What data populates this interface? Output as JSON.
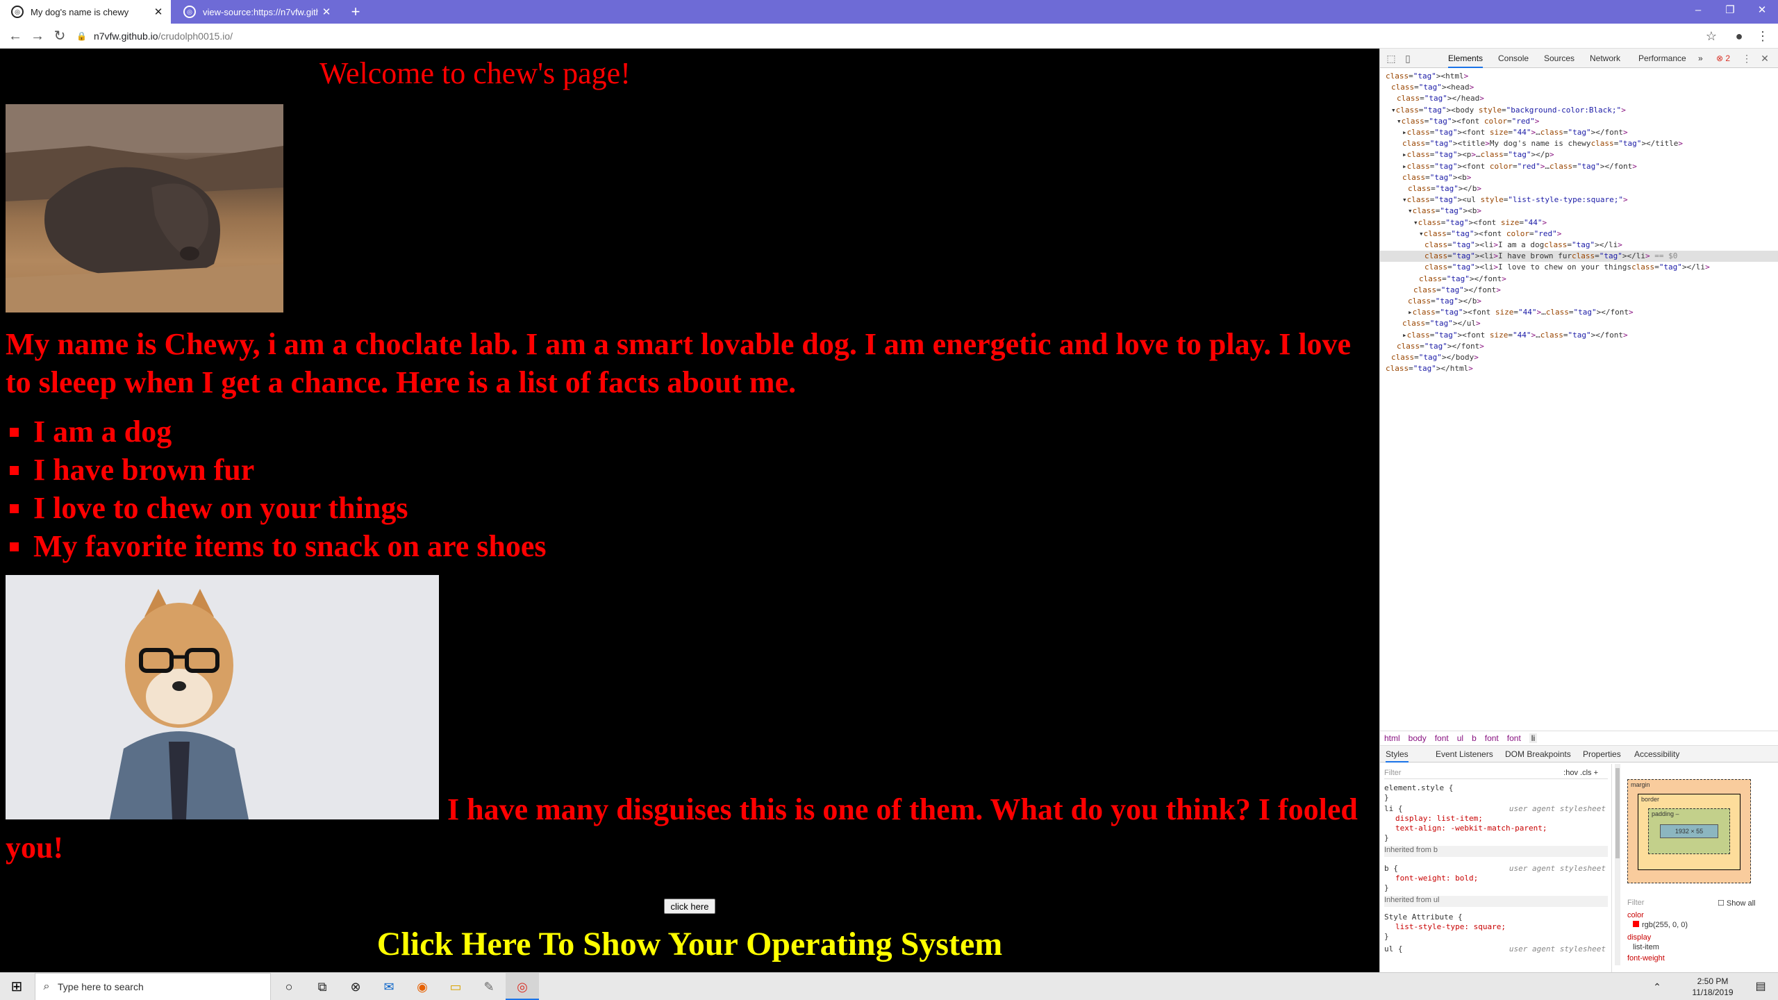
{
  "browser": {
    "tabs": [
      {
        "title": "My dog's name is chewy",
        "active": true
      },
      {
        "title": "view-source:https://n7vfw.github.",
        "active": false
      }
    ],
    "new_tab_symbol": "+",
    "window_controls": {
      "minimize": "–",
      "restore": "❐",
      "close": "✕"
    },
    "url": {
      "host": "n7vfw.github.io",
      "path": "/crudolph0015.io/"
    }
  },
  "page": {
    "welcome": "Welcome to chew's page!",
    "intro": "My name is Chewy, i am a choclate lab. I am a smart lovable dog. I am energetic and love to play. I love to sleeep when I get a chance. Here is a list of facts about me.",
    "facts": [
      "I am a dog",
      "I have brown fur",
      "I love to chew on your things",
      "My favorite items to snack on are shoes"
    ],
    "disguise_text": "I have many disguises this is one of them. What do you think? I fooled you!",
    "button_label": "click here",
    "os_link": "Click Here To Show Your Operating System",
    "colors": {
      "background": "#000000",
      "text": "#ff0000",
      "link": "#ffff00"
    }
  },
  "devtools": {
    "tabs": [
      "Elements",
      "Console",
      "Sources",
      "Network",
      "Performance"
    ],
    "more_tabs": "»",
    "error_count": "2",
    "dom_lines": [
      {
        "indent": 0,
        "html": "<html>"
      },
      {
        "indent": 1,
        "html": "<head>"
      },
      {
        "indent": 2,
        "html": "</head>"
      },
      {
        "indent": 1,
        "html": "▾<body style=\"background-color:Black;\">"
      },
      {
        "indent": 2,
        "html": "▾<font color=\"red\">"
      },
      {
        "indent": 3,
        "html": "▸<font size=\"44\">…</font>"
      },
      {
        "indent": 3,
        "html": "<title>My dog's name is chewy</title>"
      },
      {
        "indent": 3,
        "html": "▸<p>…</p>"
      },
      {
        "indent": 3,
        "html": "▸<font color=\"red\">…</font>"
      },
      {
        "indent": 3,
        "html": "<b>"
      },
      {
        "indent": 4,
        "html": "</b>"
      },
      {
        "indent": 3,
        "html": "▾<ul style=\"list-style-type:square;\">"
      },
      {
        "indent": 4,
        "html": "▾<b>"
      },
      {
        "indent": 5,
        "html": "▾<font size=\"44\">"
      },
      {
        "indent": 6,
        "html": "▾<font color=\"red\">"
      },
      {
        "indent": 7,
        "html": "<li>I am a dog</li>"
      },
      {
        "indent": 7,
        "html": "<li>I have brown fur</li> == $0",
        "selected": true
      },
      {
        "indent": 7,
        "html": "<li>I love to chew on your things</li>"
      },
      {
        "indent": 6,
        "html": "</font>"
      },
      {
        "indent": 5,
        "html": "</font>"
      },
      {
        "indent": 4,
        "html": "</b>"
      },
      {
        "indent": 4,
        "html": "▸<font size=\"44\">…</font>"
      },
      {
        "indent": 3,
        "html": "</ul>"
      },
      {
        "indent": 3,
        "html": "▸<font size=\"44\">…</font>"
      },
      {
        "indent": 2,
        "html": "</font>"
      },
      {
        "indent": 1,
        "html": "</body>"
      },
      {
        "indent": 0,
        "html": "</html>"
      }
    ],
    "breadcrumbs": [
      "html",
      "body",
      "font",
      "ul",
      "b",
      "font",
      "font",
      "li"
    ],
    "sub_tabs": [
      "Styles",
      "Event Listeners",
      "DOM Breakpoints",
      "Properties",
      "Accessibility"
    ],
    "styles": {
      "filter_placeholder": "Filter",
      "filter_options": ":hov  .cls  +",
      "element_style": "element.style {",
      "rule1": {
        "selector": "li {",
        "source": "user agent stylesheet",
        "props": [
          "display: list-item;",
          "text-align: -webkit-match-parent;"
        ]
      },
      "inherited_b": "Inherited from b",
      "rule2": {
        "selector": "b {",
        "source": "user agent stylesheet",
        "props": [
          "font-weight: bold;"
        ]
      },
      "inherited_ul": "Inherited from ul",
      "rule3": {
        "selector": "Style Attribute {",
        "props": [
          "list-style-type: square;"
        ]
      },
      "rule4": {
        "selector": "ul {",
        "source": "user agent stylesheet"
      },
      "close_brace": "}"
    },
    "box_model": {
      "margin": "margin",
      "border": "border",
      "padding": "padding –",
      "content": "1932 × 55",
      "dash": "–"
    },
    "computed": {
      "filter": "Filter",
      "show_all": "Show all",
      "items": [
        {
          "name": "color",
          "value": "rgb(255, 0, 0)"
        },
        {
          "name": "display",
          "value": "list-item"
        },
        {
          "name": "font-weight",
          "value": ""
        }
      ]
    }
  },
  "taskbar": {
    "search_placeholder": "Type here to search",
    "time": "2:50 PM",
    "date": "11/18/2019"
  }
}
